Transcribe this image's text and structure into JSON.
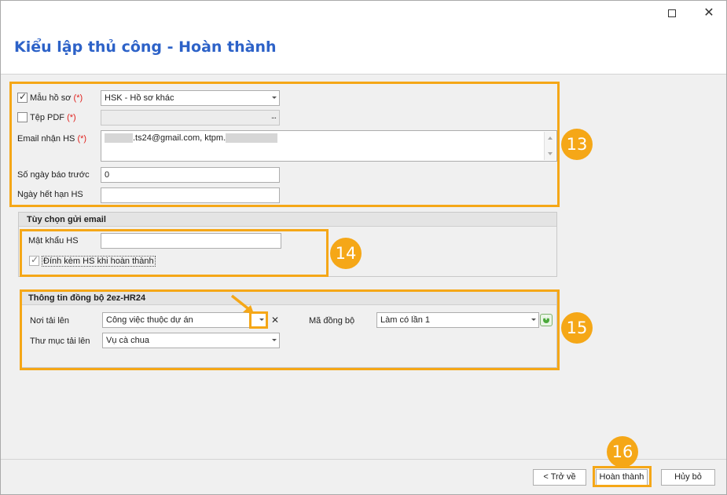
{
  "header": {
    "title": "Kiểu lập thủ công - Hoàn thành"
  },
  "form": {
    "template": {
      "label": "Mẫu hồ sơ",
      "required": "(*)",
      "value": "HSK - Hồ sơ khác",
      "checked": true
    },
    "pdf": {
      "label": "Tệp PDF",
      "required": "(*)",
      "value": "",
      "checked": false,
      "browse": "..."
    },
    "email": {
      "label": "Email nhận HS",
      "required": "(*)",
      "value_a": ".ts24@gmail.com, ktpm."
    },
    "notice_days": {
      "label": "Số ngày báo trước",
      "value": "0"
    },
    "expiry": {
      "label": "Ngày hết hạn HS",
      "value": ""
    }
  },
  "email_options": {
    "title": "Tùy chọn gửi email",
    "password": {
      "label": "Mật khẩu HS",
      "value": ""
    },
    "attach": {
      "label": "Đính kèm HS khi hoàn thành",
      "checked": true
    }
  },
  "sync": {
    "title": "Thông tin đồng bộ 2ez-HR24",
    "upload_place": {
      "label": "Nơi tải lên",
      "value": "Công việc thuộc dự án"
    },
    "upload_folder": {
      "label": "Thư mục tải lên",
      "value": "Vụ cà chua"
    },
    "sync_code": {
      "label": "Mã đồng bộ",
      "value": "Làm có lần 1"
    }
  },
  "badges": {
    "b13": "13",
    "b14": "14",
    "b15": "15",
    "b16": "16"
  },
  "buttons": {
    "back": "< Trở về",
    "finish": "Hoàn thành",
    "cancel": "Hủy bỏ"
  },
  "colors": {
    "accent": "#f5a717",
    "title": "#2d62c8",
    "required": "#e0201c"
  },
  "icons": [
    "maximize-icon",
    "close-icon",
    "chevron-down-icon",
    "check-icon",
    "clear-icon",
    "add-icon",
    "pointer-arrow-icon"
  ]
}
